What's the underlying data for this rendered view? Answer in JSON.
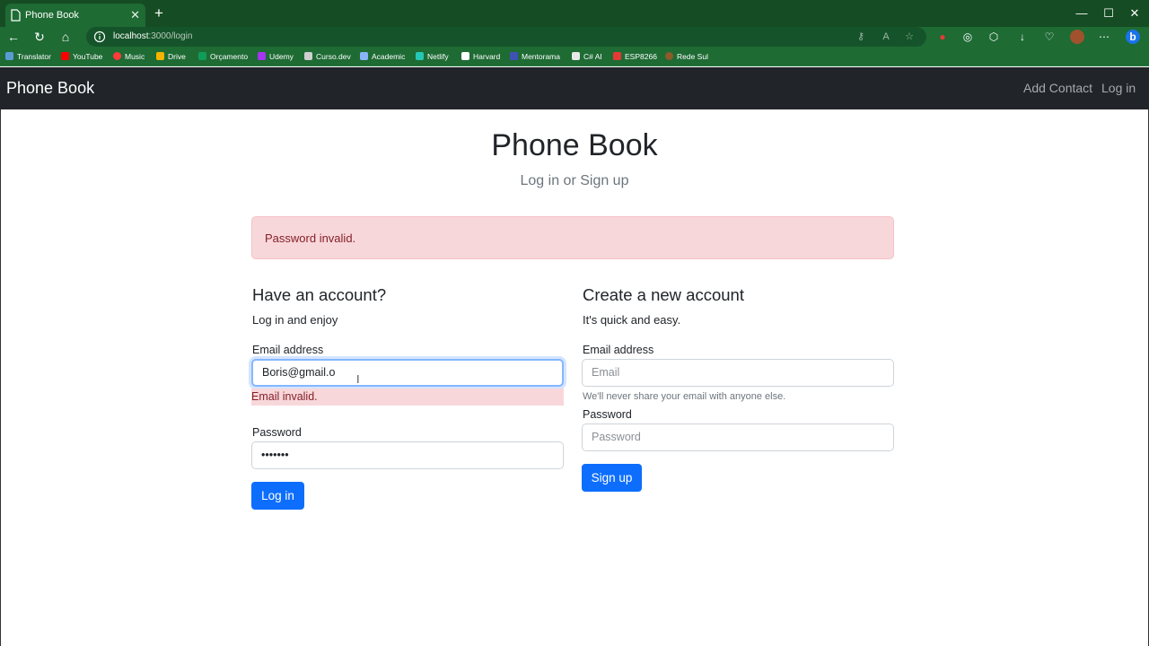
{
  "browser": {
    "tab_title": "Phone Book",
    "tab_close": "✕",
    "new_tab": "+",
    "url_host": "localhost",
    "url_path": ":3000/login",
    "window": {
      "minimize": "—",
      "maximize": "☐",
      "close": "✕"
    },
    "bookmarks": [
      {
        "label": "Translator",
        "color": "#5b9bd5"
      },
      {
        "label": "YouTube",
        "color": "#ff0000"
      },
      {
        "label": "Music",
        "color": "#ff3b3b"
      },
      {
        "label": "Drive",
        "color": "#f4b400"
      },
      {
        "label": "Orçamento",
        "color": "#0f9d58"
      },
      {
        "label": "Udemy",
        "color": "#a435f0"
      },
      {
        "label": "Curso.dev",
        "color": "#cfcfcf"
      },
      {
        "label": "Academic",
        "color": "#8ab4f8"
      },
      {
        "label": "Netlify",
        "color": "#25c7b7"
      },
      {
        "label": "Harvard",
        "color": "#ffffff"
      },
      {
        "label": "Mentorama",
        "color": "#3f51b5"
      },
      {
        "label": "C# AI",
        "color": "#e8e8e8"
      },
      {
        "label": "ESP8266",
        "color": "#e53935"
      },
      {
        "label": "Rede Sul",
        "color": "#8d5a2b"
      }
    ]
  },
  "navbar": {
    "brand": "Phone Book",
    "links": [
      "Add Contact",
      "Log in"
    ]
  },
  "header": {
    "title": "Phone Book",
    "subtitle": "Log in or Sign up"
  },
  "alert": {
    "message": "Password invalid."
  },
  "login": {
    "heading": "Have an account?",
    "subheading": "Log in and enjoy",
    "email_label": "Email address",
    "email_value": "Boris@gmail.o",
    "email_error": "Email invalid.",
    "password_label": "Password",
    "password_value": "•••••••",
    "button": "Log in"
  },
  "signup": {
    "heading": "Create a new account",
    "subheading": "It's quick and easy.",
    "email_label": "Email address",
    "email_placeholder": "Email",
    "email_help": "We'll never share your email with anyone else.",
    "password_label": "Password",
    "password_placeholder": "Password",
    "button": "Sign up"
  },
  "colors": {
    "primary": "#0d6efd",
    "danger_bg": "#f8d7da",
    "danger_text": "#842029",
    "navbar_bg": "#212529",
    "browser_chrome": "#1e6b34"
  }
}
